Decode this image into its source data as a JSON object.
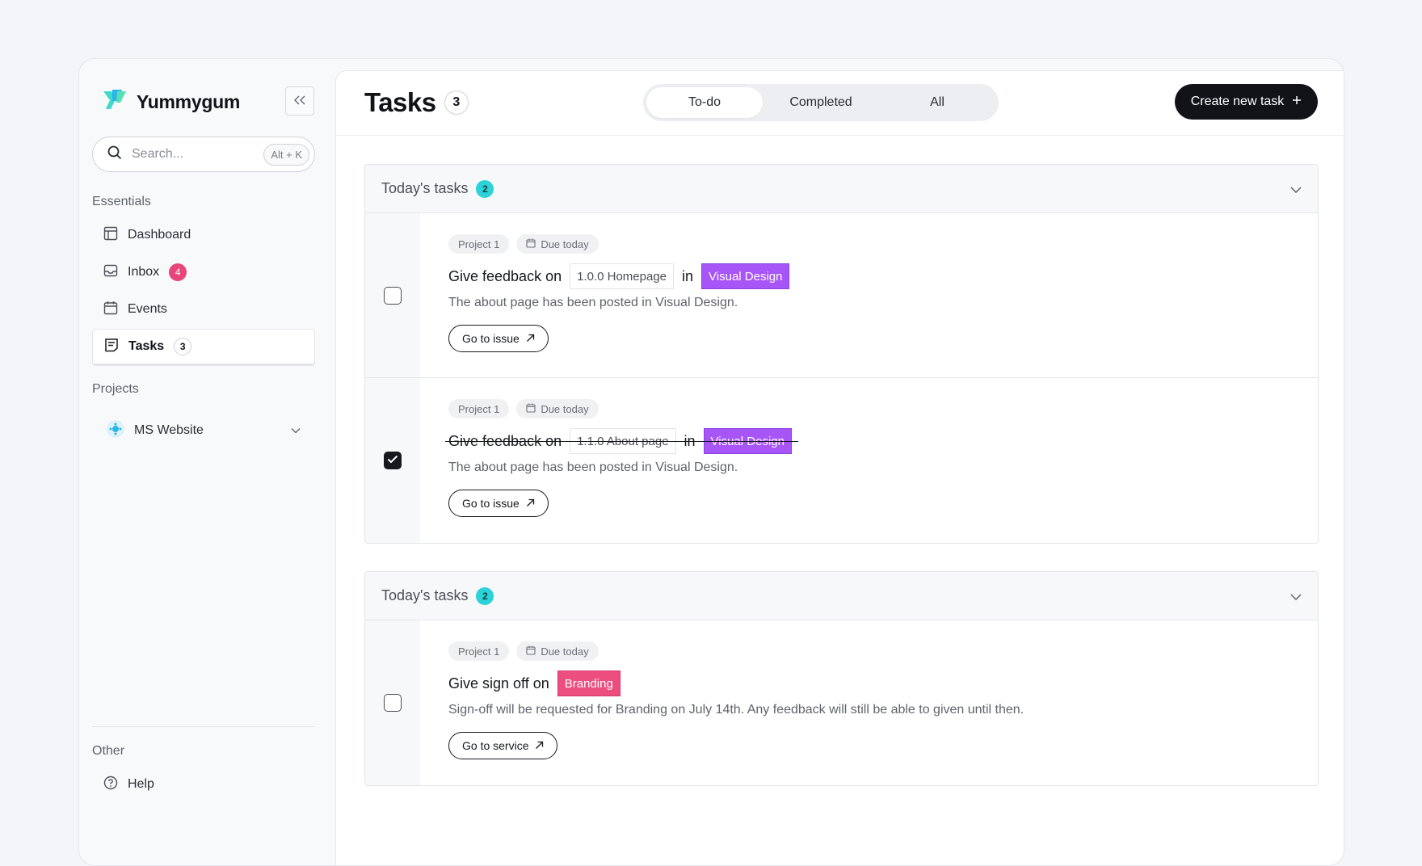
{
  "brand": {
    "name": "Yummygum"
  },
  "search": {
    "placeholder": "Search...",
    "shortcut": "Alt + K"
  },
  "sidebar": {
    "essentials_label": "Essentials",
    "items": [
      {
        "label": "Dashboard",
        "icon": "layout-icon"
      },
      {
        "label": "Inbox",
        "icon": "inbox-icon",
        "badge": "4"
      },
      {
        "label": "Events",
        "icon": "calendar-icon"
      },
      {
        "label": "Tasks",
        "icon": "tasks-icon",
        "badge": "3",
        "active": true
      }
    ],
    "projects_label": "Projects",
    "projects": [
      {
        "label": "MS Website"
      }
    ],
    "other_label": "Other",
    "other_items": [
      {
        "label": "Help",
        "icon": "help-icon"
      }
    ]
  },
  "header": {
    "title": "Tasks",
    "count": "3",
    "tabs": [
      {
        "label": "To-do",
        "active": true
      },
      {
        "label": "Completed"
      },
      {
        "label": "All"
      }
    ],
    "create_label": "Create new task"
  },
  "groups": [
    {
      "title": "Today's tasks",
      "count": "2",
      "tasks": [
        {
          "project": "Project 1",
          "due": "Due today",
          "text": "Give feedback on",
          "target": "1.0.0 Homepage",
          "in": "in",
          "tag": "Visual Design",
          "description": "The about page has been posted in Visual Design.",
          "action": "Go to issue",
          "checked": false
        },
        {
          "project": "Project 1",
          "due": "Due today",
          "text": "Give feedback on",
          "target": "1.1.0 About page",
          "in": "in",
          "tag": "Visual Design",
          "description": "The about page has been posted in Visual Design.",
          "action": "Go to issue",
          "checked": true
        }
      ]
    },
    {
      "title": "Today's tasks",
      "count": "2",
      "tasks": [
        {
          "project": "Project 1",
          "due": "Due today",
          "text": "Give sign off on",
          "tag": "Branding",
          "description": "Sign-off will be requested for Branding on July 14th. Any feedback will still be able to given until then.",
          "action": "Go to service",
          "checked": false
        }
      ]
    }
  ],
  "colors": {
    "accent_purple": "#a855f7",
    "accent_pink": "#ec4e7f",
    "accent_teal": "#2bd3d9",
    "badge_pink": "#e9457a"
  }
}
